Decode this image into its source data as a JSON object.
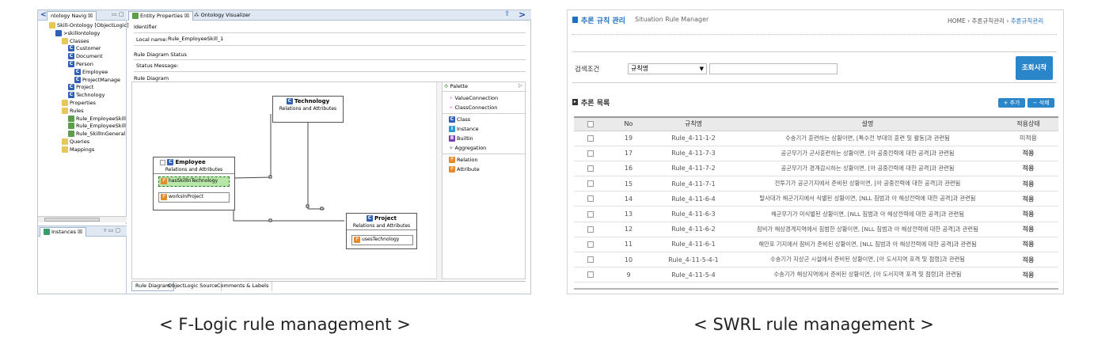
{
  "left": {
    "nav_tab": "ntology Navig ☒",
    "entity_tab": "Entity Properties ☒",
    "visualizer_tab": "Ontology Visualizer",
    "tree": [
      {
        "label": "Skill-Ontology [ObjectLogic]",
        "indent": 0,
        "icon": "db"
      },
      {
        "label": ">skillontology",
        "indent": 1,
        "icon": "ont"
      },
      {
        "label": "Classes",
        "indent": 2,
        "icon": "folder"
      },
      {
        "label": "Customer",
        "indent": 3,
        "icon": "class"
      },
      {
        "label": "Document",
        "indent": 3,
        "icon": "class"
      },
      {
        "label": "Person",
        "indent": 3,
        "icon": "class"
      },
      {
        "label": "Employee",
        "indent": 4,
        "icon": "class"
      },
      {
        "label": "ProjectManage",
        "indent": 4,
        "icon": "class"
      },
      {
        "label": "Project",
        "indent": 3,
        "icon": "class"
      },
      {
        "label": "Technology",
        "indent": 3,
        "icon": "class"
      },
      {
        "label": "Properties",
        "indent": 2,
        "icon": "folder"
      },
      {
        "label": "Rules",
        "indent": 2,
        "icon": "folder"
      },
      {
        "label": "Rule_EmployeeSkill",
        "indent": 3,
        "icon": "rule"
      },
      {
        "label": "Rule_EmployeeSkill",
        "indent": 3,
        "icon": "rule"
      },
      {
        "label": "Rule_SkillInGeneral",
        "indent": 3,
        "icon": "rule"
      },
      {
        "label": "Queries",
        "indent": 2,
        "icon": "folder"
      },
      {
        "label": "Mappings",
        "indent": 2,
        "icon": "folder"
      }
    ],
    "instances_tab": "Instances ☒",
    "identifier_label": "Identifier",
    "local_name_label": "Local name:",
    "local_name_value": "Rule_EmployeeSkill_1",
    "status_label": "Rule Diagram Status",
    "status_message_label": "Status Message:",
    "diagram_label": "Rule Diagram",
    "nodes": {
      "technology": {
        "title": "Technology",
        "sub": "Relations and Attributes"
      },
      "employee": {
        "title": "Employee",
        "sub": "Relations and Attributes",
        "attrs": [
          "hasSkillInTechnology",
          "worksInProject"
        ]
      },
      "project": {
        "title": "Project",
        "sub": "Relations and Attributes",
        "attrs": [
          "usesTechnology"
        ]
      }
    },
    "palette_title": "Palette",
    "palette_items": [
      "ValueConnection",
      "ClassConnection",
      "Class",
      "Instance",
      "Builtin",
      "Aggregation",
      "Relation",
      "Attribute"
    ],
    "bottom_tabs": [
      "Rule Diagram",
      "ObjectLogic Source",
      "Comments & Labels"
    ]
  },
  "right": {
    "title_ko": "추론 규칙 관리",
    "title_en": "Situation Rule Manager",
    "breadcrumb": [
      "HOME",
      "추론규칙관리",
      "추론규칙관리"
    ],
    "search_label": "검색조건",
    "search_select": "규칙명",
    "search_input": "",
    "search_button": "조회시작",
    "list_title": "추론 목록",
    "add_button": "+ 추가",
    "delete_button": "− 삭제",
    "columns": [
      "No",
      "규칙명",
      "설명",
      "적용상태"
    ],
    "rows": [
      {
        "no": "19",
        "name": "Rule_4-11-1-2",
        "desc": "수송기가 훈련하는 상황이면, [특수전 부대의 훈련 및 활동]과 관련됨",
        "status": "미적용",
        "applied": false
      },
      {
        "no": "17",
        "name": "Rule_4-11-7-3",
        "desc": "공군무기가 군사훈련하는 상황이면, [아 공중전력에 대한 공격]과 관련됨",
        "status": "적용",
        "applied": true
      },
      {
        "no": "16",
        "name": "Rule_4-11-7-2",
        "desc": "공군무기가 경계감시하는 상황이면, [아 공중전력에 대한 공격]과 관련됨",
        "status": "적용",
        "applied": true
      },
      {
        "no": "15",
        "name": "Rule_4-11-7-1",
        "desc": "전투기가 공군기지에서 준비된 상황이면, [아 공중전력에 대한 공격]과 관련됨",
        "status": "적용",
        "applied": true
      },
      {
        "no": "14",
        "name": "Rule_4-11-6-4",
        "desc": "탈사대가 해군기지에서 식별된 상황이면, [NLL 침범과 아 해상전력에 대한 공격]과 관련됨",
        "status": "적용",
        "applied": true
      },
      {
        "no": "13",
        "name": "Rule_4-11-6-3",
        "desc": "해군무기가 미식별된 상황이면, [NLL 침범과 아 해상전력에 대한 공격]과 관련됨",
        "status": "적용",
        "applied": true
      },
      {
        "no": "12",
        "name": "Rule_4-11-6-2",
        "desc": "잠비가 해상경계지역에서 침범한 상황이면, [NLL 침범과 아 해상전력에 대한 공격]과 관련됨",
        "status": "적용",
        "applied": true
      },
      {
        "no": "11",
        "name": "Rule_4-11-6-1",
        "desc": "해안포 기지에서 잠비가 준비된 상황이면, [NLL 침범과 아 해상전력에 대한 공격]과 관련됨",
        "status": "적용",
        "applied": true
      },
      {
        "no": "10",
        "name": "Rule_4-11-5-4-1",
        "desc": "수송기가 지상군 시설에서 준비된 상황이면, [아 도서지역 포격 및 점령]과 관련됨",
        "status": "적용",
        "applied": true
      },
      {
        "no": "9",
        "name": "Rule_4-11-5-4",
        "desc": "수송기가 해상지역에서 준비된 상황이면, [아 도서지역 포격 및 점령]과 관련됨",
        "status": "적용",
        "applied": true
      }
    ]
  },
  "captions": [
    "< F-Logic rule management >",
    "< SWRL rule management >"
  ],
  "colors": {
    "accent_blue": "#1b6fc4",
    "button_blue": "#2a86c8",
    "eclipse_tab": "#dfe8f3"
  }
}
